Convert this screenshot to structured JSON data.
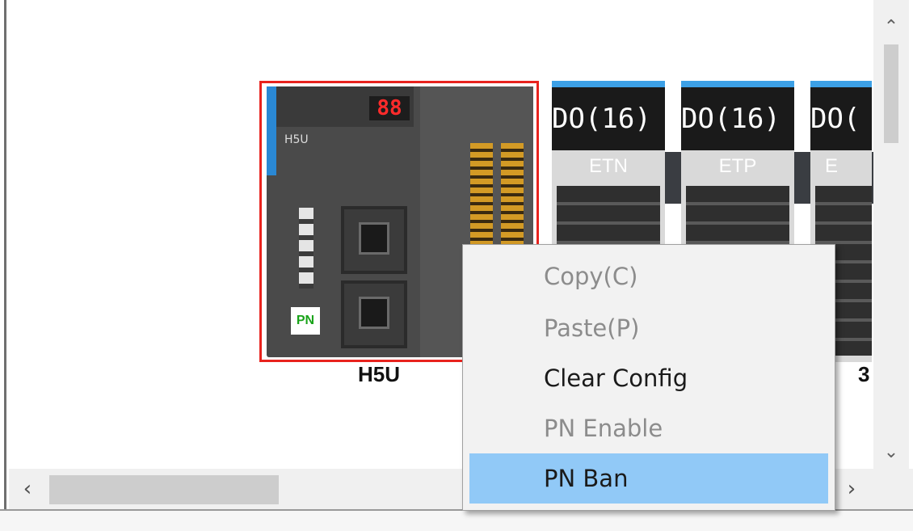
{
  "main_unit": {
    "name": "H5U",
    "display": "88",
    "model_text": "H5U",
    "pn_badge": "PN"
  },
  "modules": [
    {
      "header": "DO(16)",
      "sub": "ETN"
    },
    {
      "header": "DO(16)",
      "sub": "ETP"
    },
    {
      "header": "DO(",
      "sub": "E"
    }
  ],
  "slot_label_partial": "3",
  "context_menu": {
    "items": [
      {
        "label": "Copy(C)",
        "enabled": false
      },
      {
        "label": "Paste(P)",
        "enabled": false
      },
      {
        "label": "Clear Config",
        "enabled": true
      },
      {
        "label": "PN Enable",
        "enabled": false
      },
      {
        "label": "PN Ban",
        "enabled": true,
        "highlighted": true
      }
    ]
  },
  "scrollbars": {
    "up_icon": "chevron-up-icon",
    "down_icon": "chevron-down-icon",
    "left_icon": "chevron-left-icon",
    "right_icon": "chevron-right-icon"
  },
  "colors": {
    "selection_border": "#e8231e",
    "menu_highlight": "#91c9f7",
    "pn_badge_text": "#19a319",
    "module_cap": "#3ca0e6"
  }
}
